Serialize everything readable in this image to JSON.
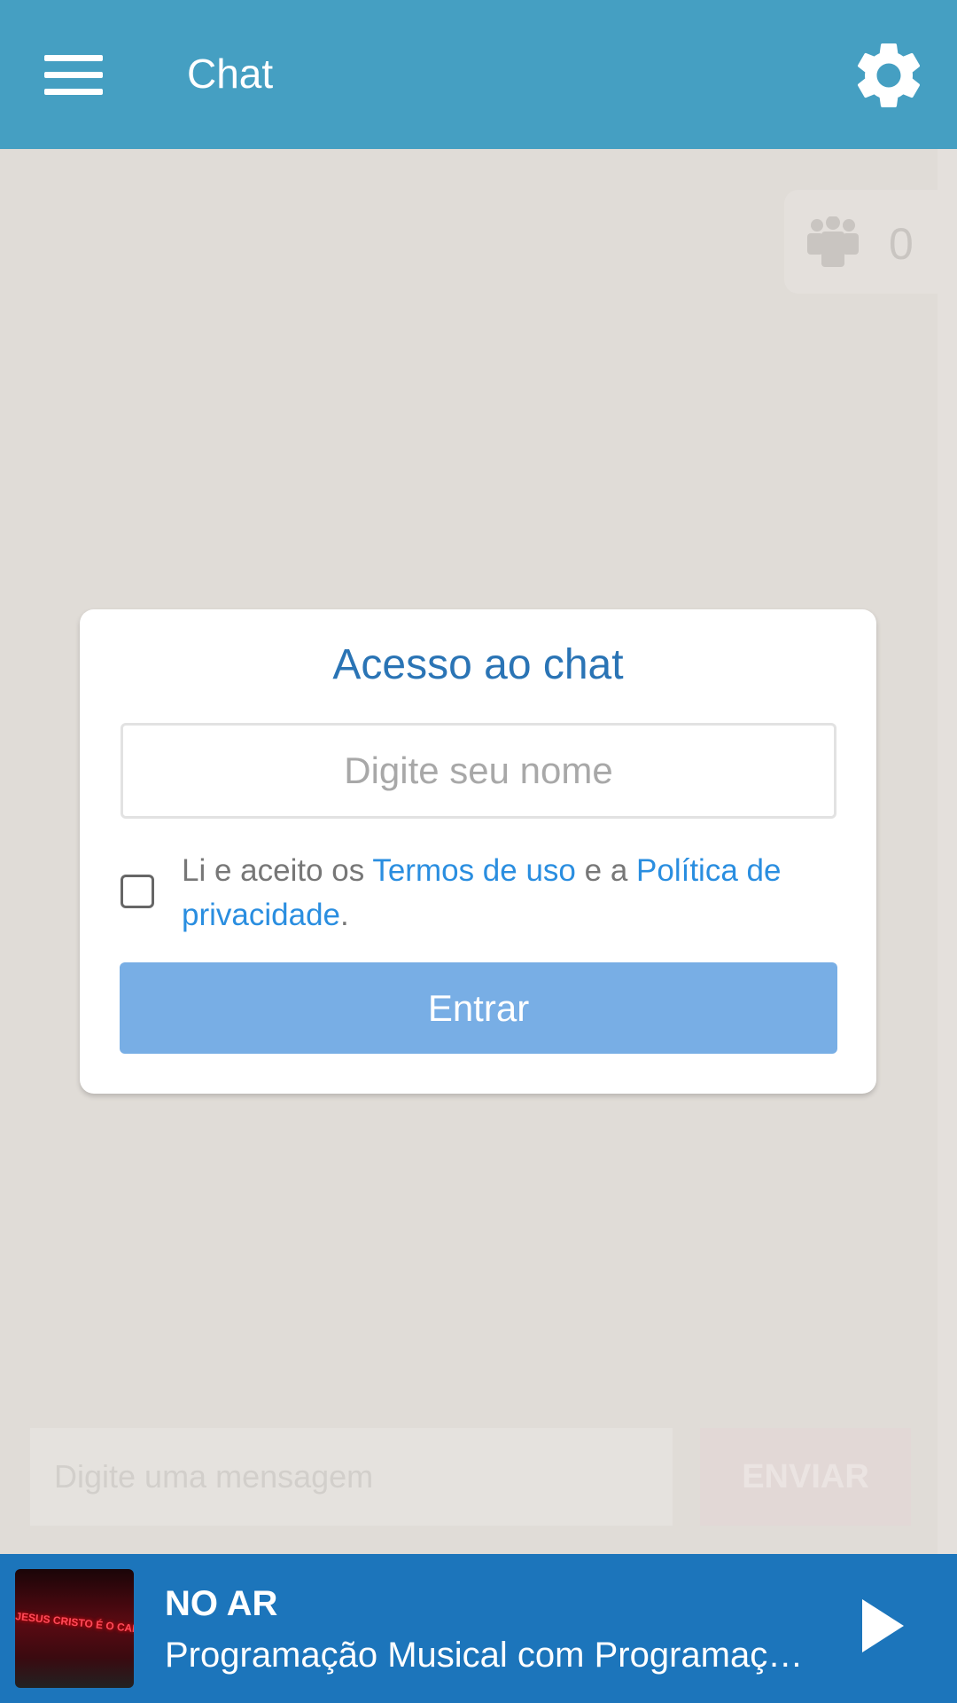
{
  "header": {
    "title": "Chat",
    "menu_icon": "hamburger-menu-icon",
    "settings_icon": "gear-icon",
    "color": "#459fc2"
  },
  "users": {
    "icon": "users-group-icon",
    "count": "0"
  },
  "dialog": {
    "title": "Acesso ao chat",
    "name_placeholder": "Digite seu nome",
    "terms_prefix": "Li e aceito os ",
    "terms_link": "Termos de uso",
    "terms_mid": " e a ",
    "privacy_link": "Política de privacidade",
    "terms_suffix": ".",
    "checked": false,
    "enter_label": "Entrar",
    "button_color": "#78aee5"
  },
  "composer": {
    "placeholder": "Digite uma mensagem",
    "send_label": "ENVIAR"
  },
  "player": {
    "thumb_text": "JESUS CRISTO É O CAMINHO",
    "status": "NO AR",
    "program": "Programação Musical com Programação Musical",
    "play_icon": "play-icon",
    "color": "#1c75bb"
  }
}
